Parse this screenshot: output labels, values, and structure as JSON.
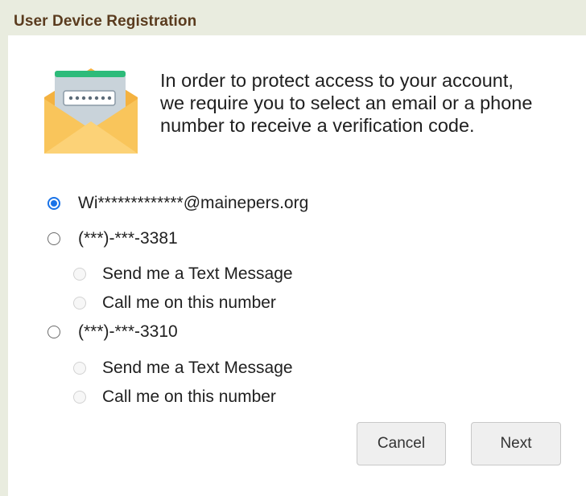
{
  "header": {
    "title": "User Device Registration"
  },
  "intro": {
    "lines": [
      "In order to protect access to your account,",
      "we require you to select an email or a phone",
      "number to receive a verification code."
    ],
    "icon": "envelope-password-icon"
  },
  "options": [
    {
      "label": "Wi*************@mainepers.org",
      "selected": true,
      "type": "email"
    },
    {
      "label": "(***)-***-3381",
      "selected": false,
      "type": "phone",
      "methods": [
        {
          "label": "Send me a Text Message",
          "enabled": false
        },
        {
          "label": "Call me on this number",
          "enabled": false
        }
      ]
    },
    {
      "label": "(***)-***-3310",
      "selected": false,
      "type": "phone",
      "methods": [
        {
          "label": "Send me a Text Message",
          "enabled": false
        },
        {
          "label": "Call me on this number",
          "enabled": false
        }
      ]
    }
  ],
  "buttons": {
    "cancel": "Cancel",
    "next": "Next"
  },
  "colors": {
    "header_bg": "#e9ecdf",
    "title_text": "#5a3b1e",
    "radio_selected": "#1a73e8",
    "envelope_body": "#f4b240",
    "envelope_flap": "#fcd277",
    "card_top": "#2dbb7a",
    "card_body": "#c9d3da"
  }
}
